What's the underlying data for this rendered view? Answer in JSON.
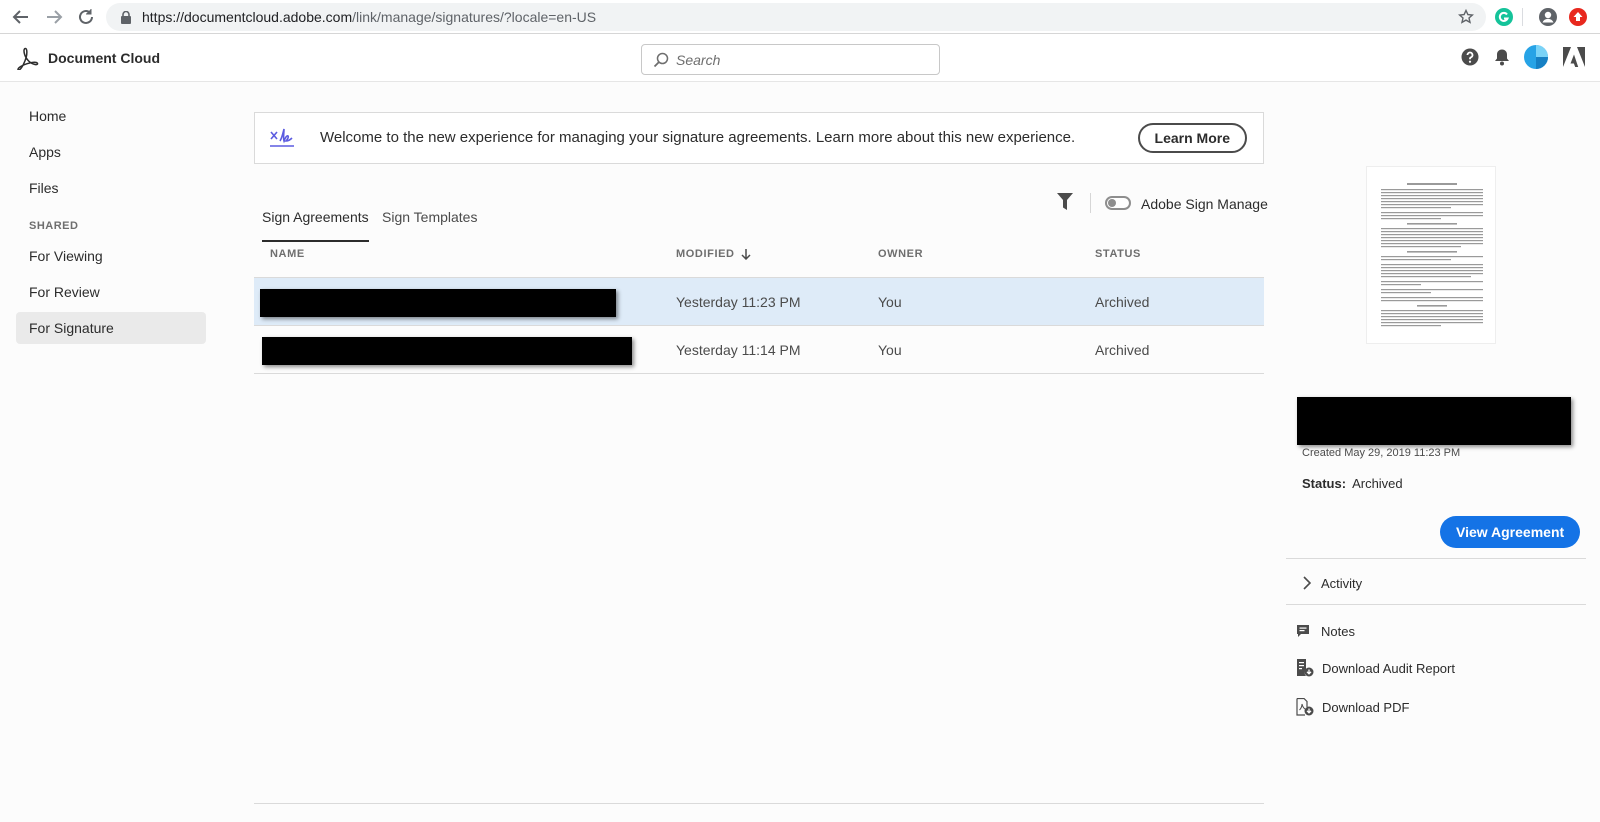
{
  "browser": {
    "url_host": "https://documentcloud.adobe.com",
    "url_path": "/link/manage/signatures/?locale=en-US"
  },
  "header": {
    "brand": "Document Cloud",
    "search_placeholder": "Search"
  },
  "sidebar": {
    "items": [
      {
        "label": "Home"
      },
      {
        "label": "Apps"
      },
      {
        "label": "Files"
      }
    ],
    "shared_heading": "SHARED",
    "shared_items": [
      {
        "label": "For Viewing"
      },
      {
        "label": "For Review"
      },
      {
        "label": "For Signature",
        "active": true
      }
    ]
  },
  "banner": {
    "text": "Welcome to the new experience for managing your signature agreements. Learn more about this new experience.",
    "button": "Learn More"
  },
  "tabs": [
    {
      "label": "Sign Agreements",
      "active": true
    },
    {
      "label": "Sign Templates"
    }
  ],
  "toolbar": {
    "toggle_label": "Adobe Sign Manage"
  },
  "table": {
    "columns": [
      "NAME",
      "MODIFIED",
      "OWNER",
      "STATUS"
    ],
    "rows": [
      {
        "modified": "Yesterday 11:23 PM",
        "owner": "You",
        "status": "Archived",
        "selected": true
      },
      {
        "modified": "Yesterday 11:14 PM",
        "owner": "You",
        "status": "Archived"
      }
    ]
  },
  "detail": {
    "created": "Created May 29, 2019 11:23 PM",
    "status_label": "Status:",
    "status_value": "Archived",
    "view_button": "View Agreement",
    "activity": "Activity",
    "notes": "Notes",
    "audit": "Download Audit Report",
    "pdf": "Download PDF"
  },
  "colors": {
    "accent": "#1473e6",
    "selected_row": "#deebf8",
    "banner_icon": "#5c5ce0"
  }
}
